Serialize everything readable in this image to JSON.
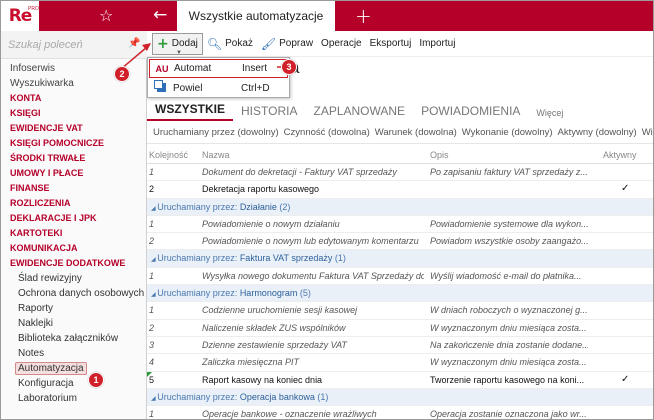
{
  "app": {
    "logo": "Re",
    "logo_sup": "PRO"
  },
  "tabs": {
    "active_title": "Wszystkie automatyzacje"
  },
  "sidebar": {
    "search_placeholder": "Szukaj poleceń",
    "items": [
      {
        "label": "Infoserwis",
        "kind": "plain"
      },
      {
        "label": "Wyszukiwarka",
        "kind": "plain"
      },
      {
        "label": "KONTA",
        "kind": "section"
      },
      {
        "label": "KSIĘGI",
        "kind": "section"
      },
      {
        "label": "EWIDENCJE VAT",
        "kind": "section"
      },
      {
        "label": "KSIĘGI POMOCNICZE",
        "kind": "section"
      },
      {
        "label": "ŚRODKI TRWAŁE",
        "kind": "section"
      },
      {
        "label": "UMOWY I PŁACE",
        "kind": "section"
      },
      {
        "label": "FINANSE",
        "kind": "section"
      },
      {
        "label": "ROZLICZENIA",
        "kind": "section"
      },
      {
        "label": "DEKLARACJE I JPK",
        "kind": "section"
      },
      {
        "label": "KARTOTEKI",
        "kind": "section"
      },
      {
        "label": "KOMUNIKACJA",
        "kind": "section"
      },
      {
        "label": "EWIDENCJE DODATKOWE",
        "kind": "section"
      },
      {
        "label": "Ślad rewizyjny",
        "kind": "sub"
      },
      {
        "label": "Ochrona danych osobowych",
        "kind": "sub"
      },
      {
        "label": "Raporty",
        "kind": "sub"
      },
      {
        "label": "Naklejki",
        "kind": "sub"
      },
      {
        "label": "Biblioteka załączników",
        "kind": "sub"
      },
      {
        "label": "Notes",
        "kind": "sub"
      },
      {
        "label": "Automatyzacja",
        "kind": "sub-active"
      },
      {
        "label": "Konfiguracja",
        "kind": "sub"
      },
      {
        "label": "Laboratorium",
        "kind": "sub"
      }
    ]
  },
  "toolbar": {
    "add": "Dodaj",
    "show": "Pokaż",
    "edit": "Popraw",
    "operations": "Operacje",
    "export": "Eksportuj",
    "import": "Importuj"
  },
  "page": {
    "title_fragment": "a"
  },
  "menu": {
    "items": [
      {
        "icon": "AU",
        "label": "Automat",
        "shortcut": "Insert"
      },
      {
        "icon": "",
        "label": "Powiel",
        "shortcut": "Ctrl+D"
      }
    ]
  },
  "subtabs": [
    "WSZYSTKIE",
    "HISTORIA",
    "ZAPLANOWANE",
    "POWIADOMIENIA",
    "Więcej"
  ],
  "filters": [
    "Uruchamiany przez (dowolny)",
    "Czynność (dowolna)",
    "Warunek (dowolna)",
    "Wykonanie (dowolny)",
    "Aktywny (dowolny)",
    "Więcej"
  ],
  "grid": {
    "headers": {
      "order": "Kolejność",
      "name": "Nazwa",
      "desc": "Opis",
      "active": "Aktywny"
    },
    "rows": [
      {
        "type": "row",
        "active": false,
        "order": "1",
        "name": "Dokument do dekretacji - Faktury VAT sprzedaży",
        "desc": "Po zapisaniu faktury VAT sprzedaży z...",
        "check": ""
      },
      {
        "type": "row",
        "active": true,
        "order": "2",
        "name": "Dekretacja raportu kasowego",
        "desc": "",
        "check": "✓"
      },
      {
        "type": "group",
        "prefix": "Uruchamiany przez: ",
        "value": "Działanie",
        "count": " (2)"
      },
      {
        "type": "row",
        "active": false,
        "order": "1",
        "name": "Powiadomienie o nowym działaniu",
        "desc": "Powiadomienie systemowe dla wykon...",
        "check": ""
      },
      {
        "type": "row",
        "active": false,
        "order": "2",
        "name": "Powiadomienie o nowym lub edytowanym komentarzu",
        "desc": "Powiadom wszystkie osoby zaangażo...",
        "check": ""
      },
      {
        "type": "group",
        "prefix": "Uruchamiany przez: ",
        "value": "Faktura VAT sprzedaży",
        "count": " (1)"
      },
      {
        "type": "row",
        "active": false,
        "order": "1",
        "name": "Wysyłka nowego dokumentu Faktura VAT Sprzedaży do...",
        "desc": "Wyślij wiadomość e-mail do płatnika...",
        "check": ""
      },
      {
        "type": "group",
        "prefix": "Uruchamiany przez: ",
        "value": "Harmonogram",
        "count": " (5)"
      },
      {
        "type": "row",
        "active": false,
        "order": "1",
        "name": "Codzienne uruchomienie sesji kasowej",
        "desc": "W dniach roboczych o wyznaczonej g...",
        "check": ""
      },
      {
        "type": "row",
        "active": false,
        "order": "2",
        "name": "Naliczenie składek ZUS wspólników",
        "desc": "W wyznaczonym dniu miesiąca zosta...",
        "check": ""
      },
      {
        "type": "row",
        "active": false,
        "order": "3",
        "name": "Dzienne zestawienie sprzedaży VAT",
        "desc": "Na zakończenie dnia zostanie dodane...",
        "check": ""
      },
      {
        "type": "row",
        "active": false,
        "order": "4",
        "name": "Zaliczka miesięczna PIT",
        "desc": "W wyznaczonym dniu miesiąca zosta...",
        "check": ""
      },
      {
        "type": "row",
        "active": true,
        "order": "5",
        "name": "Raport kasowy na koniec dnia",
        "desc": "Tworzenie raportu kasowego na koni...",
        "check": "✓",
        "flag": true
      },
      {
        "type": "group",
        "prefix": "Uruchamiany przez: ",
        "value": "Operacja bankowa",
        "count": " (1)"
      },
      {
        "type": "row",
        "active": false,
        "order": "1",
        "name": "Operacje bankowe - oznaczenie wrażliwych",
        "desc": "Operacja zostanie oznaczona jako wr...",
        "check": ""
      }
    ]
  },
  "callouts": [
    "1",
    "2",
    "3"
  ],
  "colors": {
    "brand": "#b5002a",
    "callout": "#d0202a",
    "group_text": "#4a78b0"
  }
}
